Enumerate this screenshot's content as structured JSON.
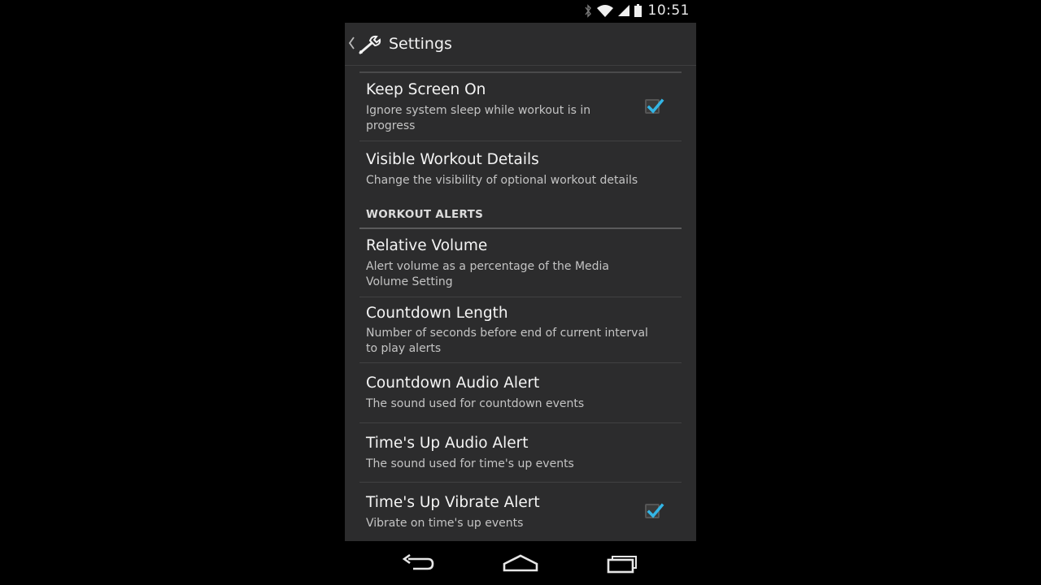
{
  "status_bar": {
    "time": "10:51",
    "icons": [
      "bluetooth-icon",
      "wifi-icon",
      "signal-icon",
      "battery-icon"
    ]
  },
  "action_bar": {
    "title": "Settings",
    "icon": "wrench-icon",
    "up": "up-caret-icon"
  },
  "preferences": [
    {
      "title": "Keep Screen On",
      "summary": "Ignore system sleep while workout is in progress",
      "checked": true
    },
    {
      "title": "Visible Workout Details",
      "summary": "Change the visibility of optional workout details"
    },
    {
      "title": "Relative Volume",
      "summary": "Alert volume as a percentage of the Media Volume Setting"
    },
    {
      "title": "Countdown Length",
      "summary": "Number of seconds before end of current interval to play alerts"
    },
    {
      "title": "Countdown Audio Alert",
      "summary": "The sound used for countdown events"
    },
    {
      "title": "Time's Up Audio Alert",
      "summary": "The sound used for time's up events"
    },
    {
      "title": "Time's Up Vibrate Alert",
      "summary": "Vibrate on time's up events",
      "checked": true
    }
  ],
  "categories": {
    "workout_alerts": "WORKOUT ALERTS"
  },
  "nav_bar": {
    "buttons": [
      "back-icon",
      "home-icon",
      "recents-icon"
    ]
  },
  "colors": {
    "accent": "#33b5e5",
    "background": "#2c2c2d",
    "divider": "#414142"
  }
}
